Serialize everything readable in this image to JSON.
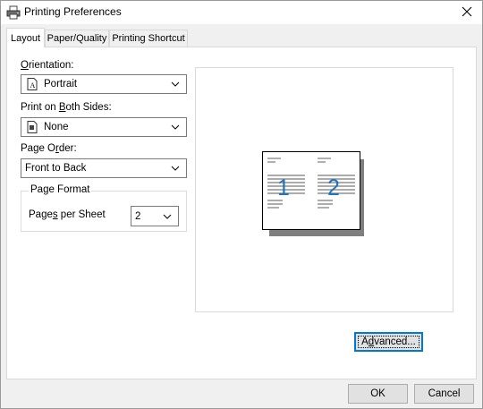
{
  "window": {
    "title": "Printing Preferences",
    "icon": "printer-icon"
  },
  "tabs": [
    {
      "label": "Layout",
      "active": true
    },
    {
      "label": "Paper/Quality",
      "active": false
    },
    {
      "label": "Printing Shortcut",
      "active": false
    }
  ],
  "layout": {
    "orientation": {
      "label_mnemonic": "O",
      "label_rest": "rientation:",
      "value": "Portrait",
      "icon": "portrait-page-icon"
    },
    "both_sides": {
      "label_pre": "Print on ",
      "label_mnemonic": "B",
      "label_rest": "oth Sides:",
      "value": "None",
      "icon": "duplex-none-icon"
    },
    "page_order": {
      "label_pre": "Page O",
      "label_mnemonic": "r",
      "label_rest": "der:",
      "value": "Front to Back"
    },
    "page_format": {
      "title": "Page Format",
      "pages_per_sheet": {
        "label_pre": "Page",
        "label_mnemonic": "s",
        "label_rest": " per Sheet",
        "value": "2"
      }
    },
    "preview": {
      "page_numbers": [
        "1",
        "2"
      ],
      "accent_color": "#1e73be"
    },
    "advanced_button": {
      "label_pre": "A",
      "label_mnemonic": "d",
      "label_rest": "vanced..."
    }
  },
  "footer": {
    "ok_label": "OK",
    "cancel_label": "Cancel"
  }
}
